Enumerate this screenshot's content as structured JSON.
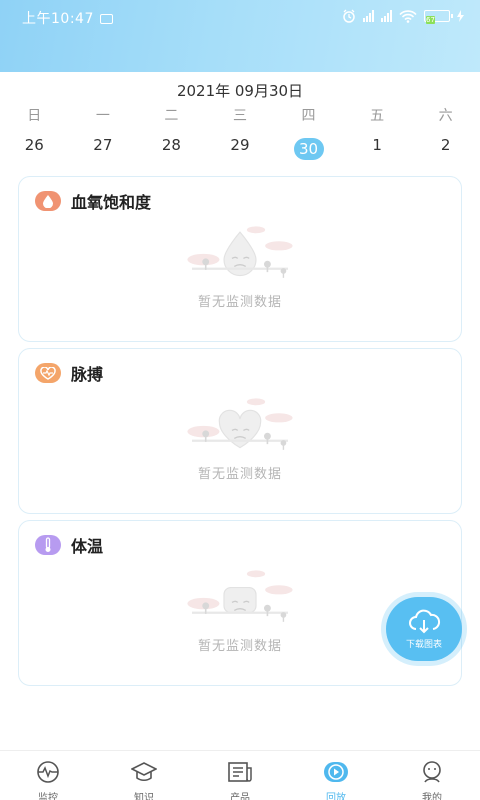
{
  "status": {
    "time": "上午10:47",
    "battery": "67"
  },
  "calendar": {
    "date_header": "2021年 09月30日",
    "weekdays": [
      "日",
      "一",
      "二",
      "三",
      "四",
      "五",
      "六"
    ],
    "days": [
      "26",
      "27",
      "28",
      "29",
      "30",
      "1",
      "2"
    ],
    "selected_index": 4
  },
  "cards": [
    {
      "title": "血氧饱和度",
      "empty_text": "暂无监测数据",
      "icon": "blood-drop-icon",
      "color": "#f09372"
    },
    {
      "title": "脉搏",
      "empty_text": "暂无监测数据",
      "icon": "heart-pulse-icon",
      "color": "#f4a56a"
    },
    {
      "title": "体温",
      "empty_text": "暂无监测数据",
      "icon": "thermometer-icon",
      "color": "#b79bf0"
    }
  ],
  "download": {
    "label": "下载图表",
    "icon": "cloud-download-icon",
    "color": "#58bff2"
  },
  "tabbar": {
    "tabs": [
      {
        "label": "监控",
        "icon": "heartbeat-monitor-icon"
      },
      {
        "label": "知识",
        "icon": "graduation-cap-icon"
      },
      {
        "label": "产品",
        "icon": "newspaper-icon"
      },
      {
        "label": "回放",
        "icon": "play-circle-icon"
      },
      {
        "label": "我的",
        "icon": "user-face-icon"
      }
    ],
    "active_index": 3,
    "active_color": "#4fb8ee"
  }
}
